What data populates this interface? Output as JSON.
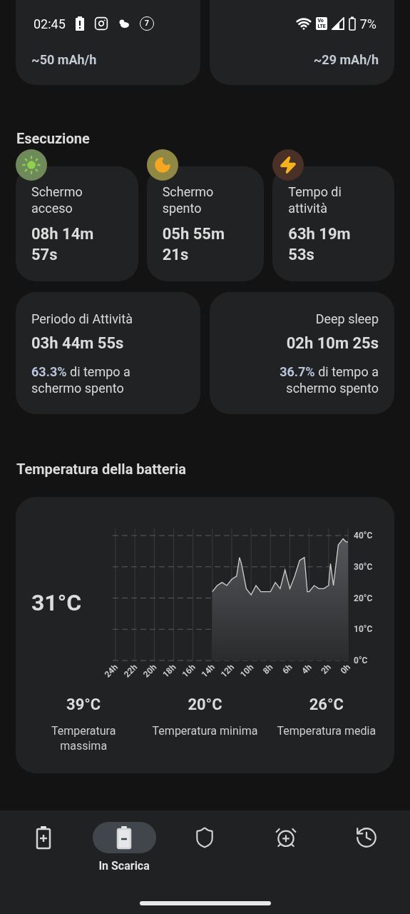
{
  "status_bar": {
    "time": "02:45",
    "notification_count": "7",
    "network_badge": [
      "Vo",
      "LTE"
    ],
    "battery": "7%"
  },
  "consumption_cards": [
    {
      "rate": "~50 mAh/h"
    },
    {
      "rate": "~29 mAh/h"
    }
  ],
  "execution": {
    "title": "Esecuzione",
    "stats": [
      {
        "kind": "sun",
        "label": "Schermo acceso",
        "value": "08h 14m 57s"
      },
      {
        "kind": "moon",
        "label": "Schermo spento",
        "value": "05h 55m 21s"
      },
      {
        "kind": "bolt",
        "label": "Tempo di attività",
        "value": "63h 19m 53s"
      }
    ],
    "periods": [
      {
        "label": "Periodo di Attività",
        "value": "03h 44m 55s",
        "note": "**63.3%** di tempo a schermo spento"
      },
      {
        "label": "Deep sleep",
        "value": "02h 10m 25s",
        "note": "**36.7%** di tempo a schermo spento"
      }
    ]
  },
  "temperature": {
    "title": "Temperatura della batteria",
    "current": "31°C",
    "chart_data": {
      "type": "area",
      "x": [
        14,
        13.5,
        13,
        12.5,
        12,
        11.5,
        11.2,
        11,
        10.5,
        10,
        9.5,
        9,
        8.5,
        8,
        7.5,
        7,
        6.5,
        6,
        5.5,
        5,
        4.5,
        4.2,
        4,
        3.5,
        3,
        2.5,
        2,
        1.8,
        1.5,
        1,
        0.5,
        0.2,
        0
      ],
      "xticks": [
        {
          "value": 24,
          "label": "24h"
        },
        {
          "value": 22,
          "label": "22h"
        },
        {
          "value": 20,
          "label": "20h"
        },
        {
          "value": 18,
          "label": "18h"
        },
        {
          "value": 16,
          "label": "16h"
        },
        {
          "value": 14,
          "label": "14h"
        },
        {
          "value": 12,
          "label": "12h"
        },
        {
          "value": 10,
          "label": "10h"
        },
        {
          "value": 8,
          "label": "8h"
        },
        {
          "value": 6,
          "label": "6h"
        },
        {
          "value": 4,
          "label": "4h"
        },
        {
          "value": 2,
          "label": "2h"
        },
        {
          "value": 0,
          "label": "0h"
        }
      ],
      "yticks": [
        {
          "value": 40,
          "label": "40°C"
        },
        {
          "value": 30,
          "label": "30°C"
        },
        {
          "value": 20,
          "label": "20°C"
        },
        {
          "value": 10,
          "label": "10°C"
        },
        {
          "value": 0,
          "label": "0°C"
        }
      ],
      "xlim": [
        24,
        0
      ],
      "ylim": [
        0,
        40
      ],
      "grid": true,
      "series": [
        {
          "color": "#d0d0d0",
          "values": [
            22,
            24,
            25,
            24,
            26,
            27,
            33,
            31,
            23,
            21,
            24,
            22,
            22,
            22,
            25,
            23,
            29,
            23,
            27,
            32,
            33,
            22,
            22,
            24,
            23,
            23,
            24,
            31,
            24,
            37,
            39,
            38,
            38
          ]
        }
      ]
    },
    "stats": [
      {
        "value": "39°C",
        "label": "Temperatura massima"
      },
      {
        "value": "20°C",
        "label": "Temperatura minima"
      },
      {
        "value": "26°C",
        "label": "Temperatura media"
      }
    ]
  },
  "nav": [
    {
      "kind": "battery-plus",
      "selected": false
    },
    {
      "kind": "battery-minus",
      "label": "In Scarica",
      "selected": true
    },
    {
      "kind": "shield",
      "selected": false
    },
    {
      "kind": "alarm",
      "selected": false
    },
    {
      "kind": "history",
      "selected": false
    }
  ]
}
